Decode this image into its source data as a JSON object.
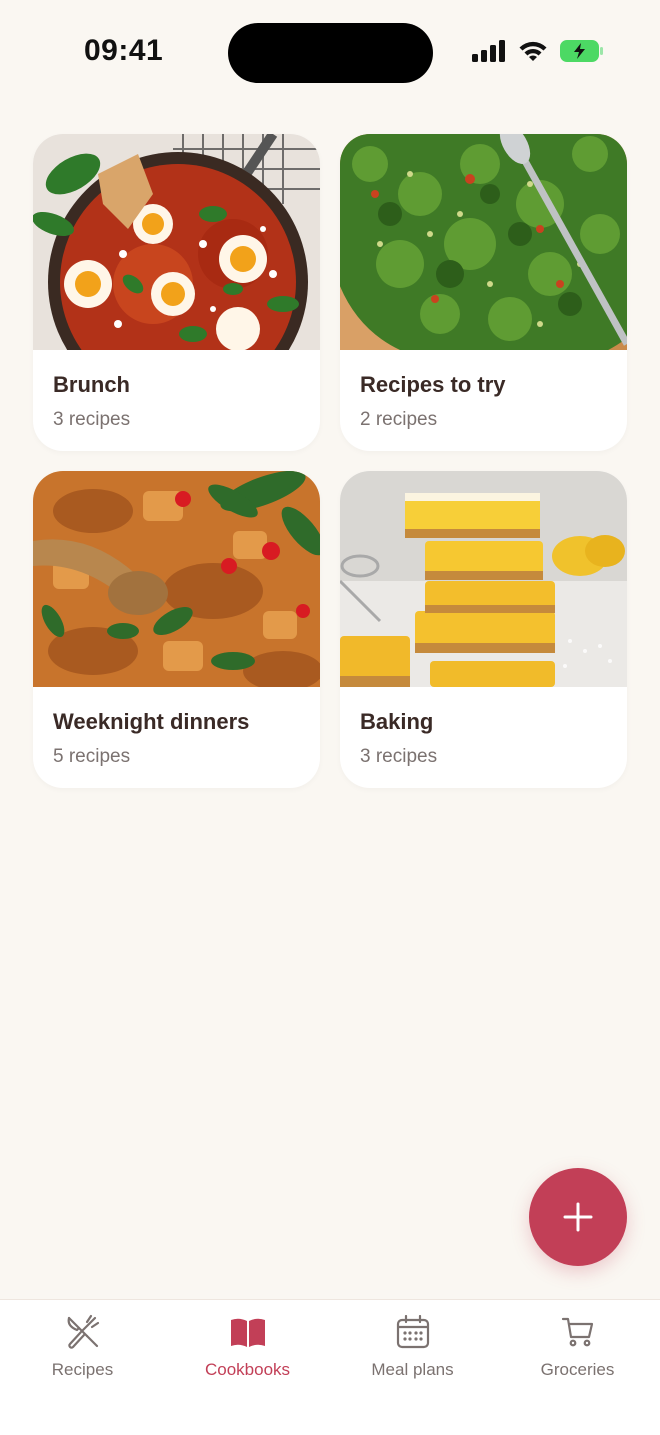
{
  "status_bar": {
    "time": "09:41"
  },
  "cookbooks": [
    {
      "title": "Brunch",
      "count": "3 recipes",
      "image_icon": "shakshuka-photo"
    },
    {
      "title": "Recipes to try",
      "count": "2 recipes",
      "image_icon": "tabbouleh-photo"
    },
    {
      "title": "Weeknight dinners",
      "count": "5 recipes",
      "image_icon": "curry-photo"
    },
    {
      "title": "Baking",
      "count": "3 recipes",
      "image_icon": "lemon-bars-photo"
    }
  ],
  "fab": {
    "icon": "plus-icon"
  },
  "tabs": [
    {
      "label": "Recipes",
      "icon": "utensils-icon",
      "active": false
    },
    {
      "label": "Cookbooks",
      "icon": "book-icon",
      "active": true
    },
    {
      "label": "Meal plans",
      "icon": "calendar-icon",
      "active": false
    },
    {
      "label": "Groceries",
      "icon": "cart-icon",
      "active": false
    }
  ],
  "colors": {
    "background": "#FAF7F2",
    "accent": "#C23F57",
    "text_primary": "#3a2a26",
    "text_secondary": "#7b7270"
  }
}
